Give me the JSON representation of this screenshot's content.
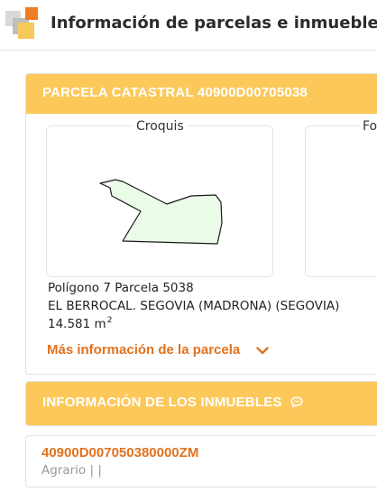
{
  "header": {
    "title": "Información de parcelas e inmuebles",
    "logo_icon": "catastro-logo-icon"
  },
  "parcela": {
    "heading": "PARCELA CATASTRAL 40900D00705038",
    "croquis_label": "Croquis",
    "foto_label": "Foto",
    "poligono_line": "Polígono 7 Parcela 5038",
    "locality_line": "EL BERROCAL. SEGOVIA (MADRONA) (SEGOVIA)",
    "area_value": "14.581 m",
    "area_unit_sup": "2",
    "more_info_link": "Más información de la parcela",
    "more_info_icon": "chevron-down-icon"
  },
  "inmuebles": {
    "heading": "INFORMACIÓN DE LOS INMUEBLES",
    "heading_icon": "comment-icon",
    "items": [
      {
        "reference": "40900D007050380000ZM",
        "use_line": "Agrario | |"
      }
    ]
  },
  "colors": {
    "card_header_bg": "#fcc85a",
    "link_orange": "#e2711d",
    "parcel_fill": "#eafbe8"
  }
}
